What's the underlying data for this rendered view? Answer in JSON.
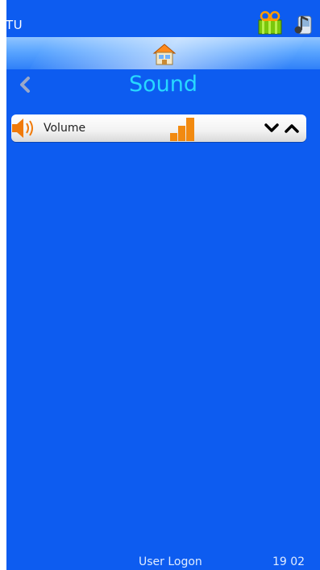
{
  "topbar": {
    "device_label": "TU",
    "status_icons": [
      "reel-icon",
      "music-note-icon"
    ]
  },
  "nav": {
    "home_icon": "home-icon",
    "back_icon": "chevron-left-icon"
  },
  "page": {
    "title": "Sound"
  },
  "settings": [
    {
      "icon": "speaker-icon",
      "label": "Volume",
      "level_icon": "volume-level-bars",
      "controls": [
        "chevron-down-icon",
        "chevron-up-icon"
      ]
    }
  ],
  "footer": {
    "logon": "User Logon",
    "clock": "19 02"
  },
  "colors": {
    "background": "#0d5cf0",
    "title": "#27d8ff",
    "accent": "#f28a10",
    "row_bg": "#f2f2f2"
  }
}
